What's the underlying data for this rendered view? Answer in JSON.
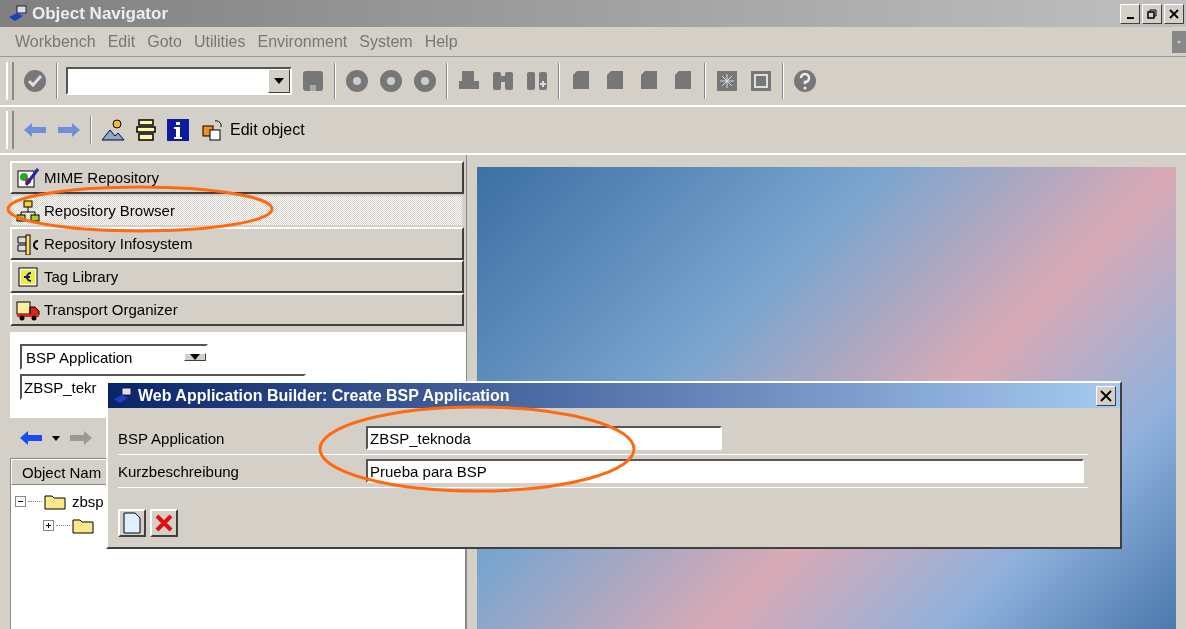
{
  "window": {
    "title": "Object Navigator"
  },
  "menu": [
    "Workbench",
    "Edit",
    "Goto",
    "Utilities",
    "Environment",
    "System",
    "Help"
  ],
  "app_toolbar": {
    "edit_label": "Edit object"
  },
  "navigator": [
    {
      "label": "MIME Repository",
      "selected": false
    },
    {
      "label": "Repository Browser",
      "selected": true
    },
    {
      "label": "Repository Infosystem",
      "selected": false
    },
    {
      "label": "Tag Library",
      "selected": false
    },
    {
      "label": "Transport Organizer",
      "selected": false
    }
  ],
  "browser": {
    "object_type": "BSP Application",
    "object_name": "ZBSP_tekr",
    "tree_header": "Object Nam",
    "tree": [
      {
        "label": "zbsp",
        "expanded": true,
        "children": [
          {
            "expanded": false
          }
        ]
      }
    ]
  },
  "dialog": {
    "title": "Web Application Builder: Create BSP Application",
    "fields": [
      {
        "label": "BSP Application",
        "value": "ZBSP_teknoda"
      },
      {
        "label": "Kurzbeschreibung",
        "value": "Prueba para BSP"
      }
    ]
  }
}
